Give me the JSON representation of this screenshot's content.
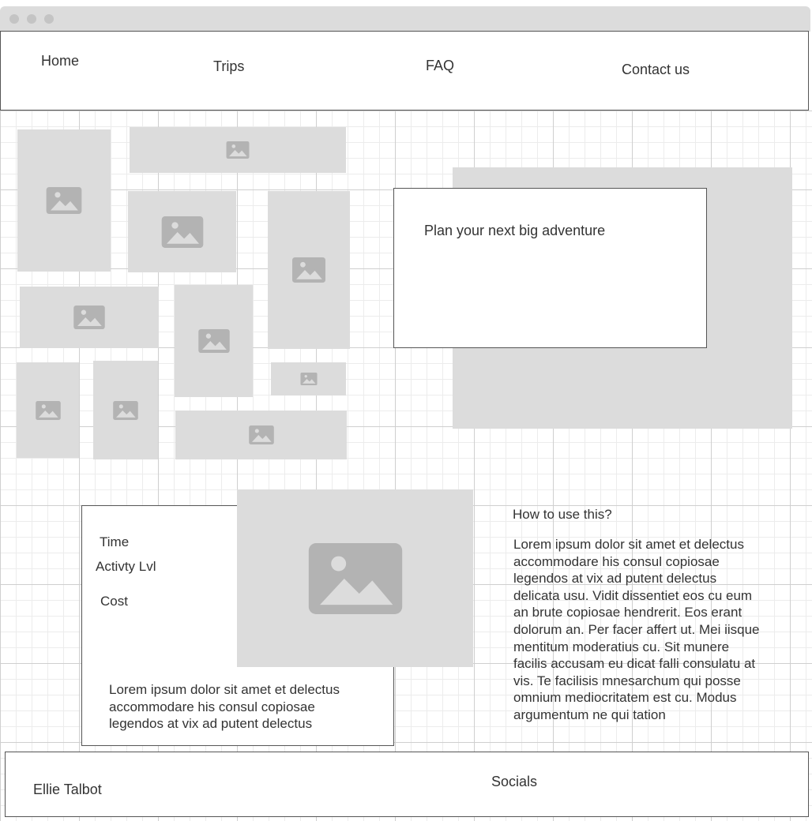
{
  "nav": {
    "items": [
      {
        "label": "Home"
      },
      {
        "label": "Trips"
      },
      {
        "label": "FAQ"
      },
      {
        "label": "Contact us"
      }
    ]
  },
  "hero": {
    "title": "Plan your next big adventure"
  },
  "trip_card": {
    "fields": [
      {
        "label": "Time"
      },
      {
        "label": "Activty Lvl"
      },
      {
        "label": "Cost"
      }
    ],
    "description": "Lorem ipsum dolor sit amet et delectus accommodare his consul copiosae legendos at vix ad putent delectus"
  },
  "help": {
    "title": "How to use this?",
    "body": "Lorem ipsum dolor sit amet et delectus accommodare his consul copiosae legendos at vix ad putent delectus delicata usu. Vidit dissentiet eos cu eum an brute copiosae hendrerit. Eos erant dolorum an. Per facer affert ut. Mei iisque mentitum moderatius cu. Sit munere facilis accusam eu dicat falli consulatu at vis. Te facilisis mnesarchum qui posse omnium mediocritatem est cu. Modus argumentum ne qui tation"
  },
  "footer": {
    "name": "Ellie Talbot",
    "socials_label": "Socials"
  },
  "colors": {
    "placeholder_bg": "#dcdcdc",
    "placeholder_icon": "#b3b3b3",
    "border": "#555555",
    "text": "#333333"
  },
  "icons": {
    "image_placeholder": "image-placeholder-icon",
    "window_controls": "window-dot-icon"
  }
}
